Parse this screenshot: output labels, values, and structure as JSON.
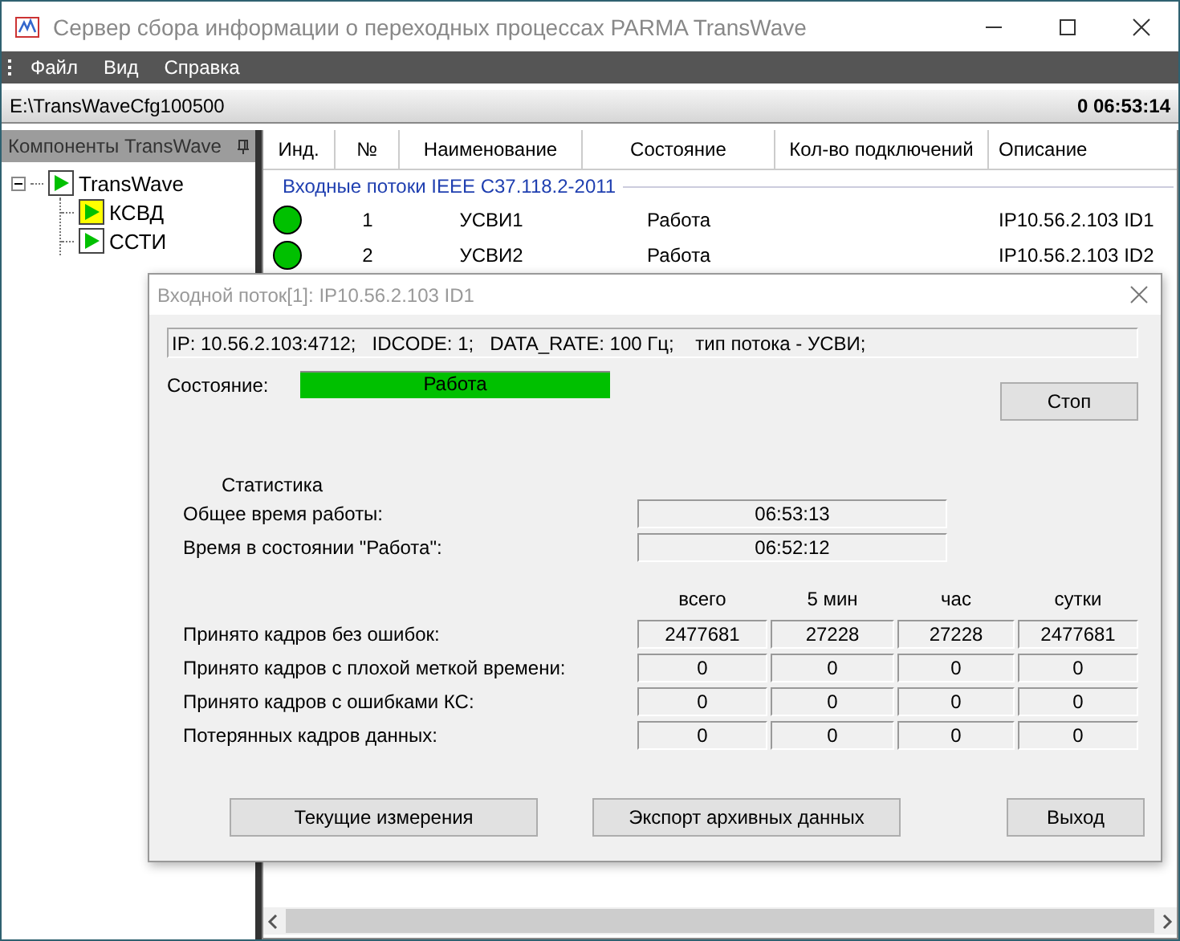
{
  "window": {
    "title": "Сервер сбора информации о переходных процессах PARMA TransWave"
  },
  "menu": [
    "Файл",
    "Вид",
    "Справка"
  ],
  "path_bar": {
    "path": "E:\\TransWaveCfg100500",
    "uptime": "0 06:53:14"
  },
  "components_panel": {
    "title": "Компоненты TransWave",
    "tree": [
      {
        "label": "TransWave",
        "expanded": true,
        "highlighted": false,
        "children": [
          {
            "label": "КСВД",
            "highlighted": true
          },
          {
            "label": "ССТИ",
            "highlighted": false
          }
        ]
      }
    ]
  },
  "table": {
    "columns": [
      "Инд.",
      "№",
      "Наименование",
      "Состояние",
      "Кол-во подключений",
      "Описание"
    ],
    "group": "Входные потоки IEEE C37.118.2-2011",
    "rows": [
      {
        "color": "#00c000",
        "number": "1",
        "name": "УСВИ1",
        "state": "Работа",
        "description": "IP10.56.2.103 ID1"
      },
      {
        "color": "#00c000",
        "number": "2",
        "name": "УСВИ2",
        "state": "Работа",
        "description": "IP10.56.2.103 ID2"
      }
    ]
  },
  "dialog": {
    "title": "Входной поток[1]: IP10.56.2.103 ID1",
    "info": "IP: 10.56.2.103:4712;   IDCODE: 1;   DATA_RATE: 100 Гц;    тип потока - УСВИ;",
    "state_label": "Состояние:",
    "state_value": "Работа",
    "stop_button": "Стоп",
    "stats_title": "Статистика",
    "times": [
      {
        "label": "Общее время работы:",
        "value": "06:53:13"
      },
      {
        "label": "Время в состоянии \"Работа\":",
        "value": "06:52:12"
      }
    ],
    "frame_columns": [
      "всего",
      "5 мин",
      "час",
      "сутки"
    ],
    "frame_rows": [
      {
        "label": "Принято кадров без ошибок:",
        "values": [
          "2477681",
          "27228",
          "27228",
          "2477681"
        ]
      },
      {
        "label": "Принято кадров с плохой меткой времени:",
        "values": [
          "0",
          "0",
          "0",
          "0"
        ]
      },
      {
        "label": "Принято кадров с ошибками КС:",
        "values": [
          "0",
          "0",
          "0",
          "0"
        ]
      },
      {
        "label": "Потерянных кадров данных:",
        "values": [
          "0",
          "0",
          "0",
          "0"
        ]
      }
    ],
    "buttons": [
      "Текущие измерения",
      "Экспорт архивных данных",
      "Выход"
    ]
  }
}
